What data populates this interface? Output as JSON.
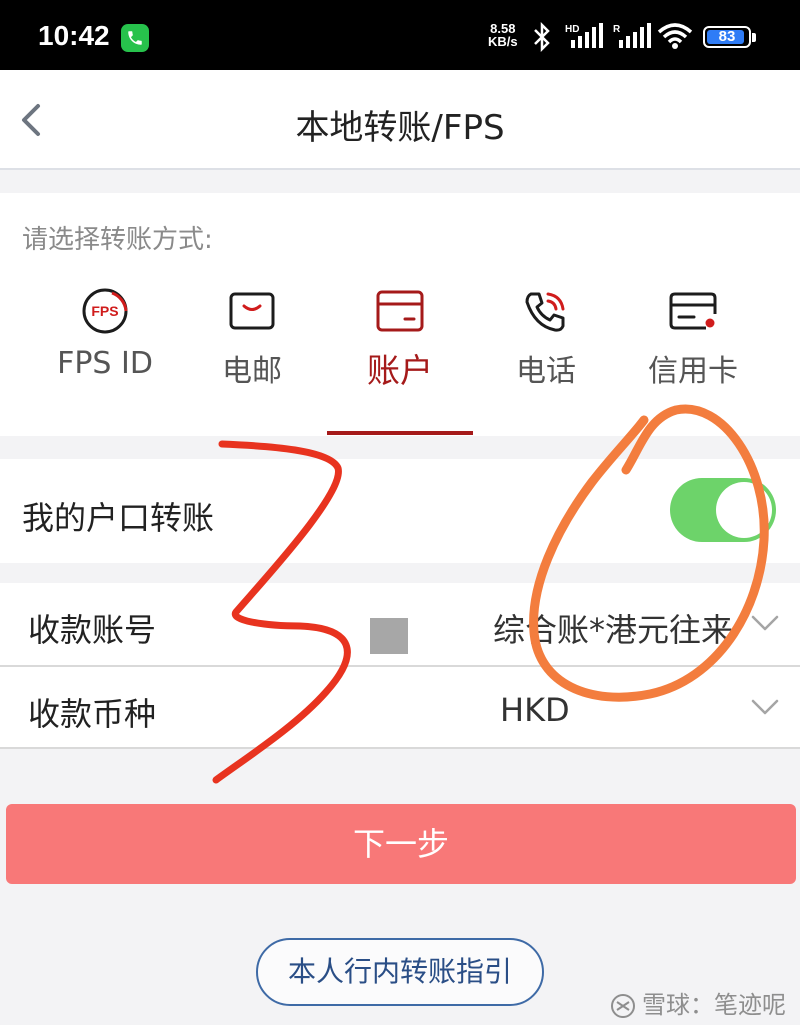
{
  "status_bar": {
    "time": "10:42",
    "net_speed_value": "8.58",
    "net_speed_unit": "KB/s",
    "battery_level": "83"
  },
  "nav": {
    "title": "本地转账/FPS"
  },
  "methods": {
    "prompt": "请选择转账方式:",
    "tabs": [
      {
        "label": "FPS ID",
        "icon": "fps-icon",
        "icon_text": "FPS"
      },
      {
        "label": "电邮",
        "icon": "email-icon"
      },
      {
        "label": "账户",
        "icon": "bank-card-icon",
        "active": true
      },
      {
        "label": "电话",
        "icon": "phone-icon"
      },
      {
        "label": "信用卡",
        "icon": "credit-card-icon"
      }
    ]
  },
  "own_transfer": {
    "label": "我的户口转账",
    "enabled": true
  },
  "form": {
    "account_label": "收款账号",
    "account_value": "综合账*港元往来",
    "currency_label": "收款币种",
    "currency_value": "HKD"
  },
  "buttons": {
    "next": "下一步",
    "guide": "本人行内转账指引"
  },
  "watermark": "雪球：笔迹呢",
  "colors": {
    "accent": "#a51a1a",
    "toggle_on": "#6dd36a",
    "next_button": "#f87878",
    "guide_border": "#3e6aa6"
  }
}
